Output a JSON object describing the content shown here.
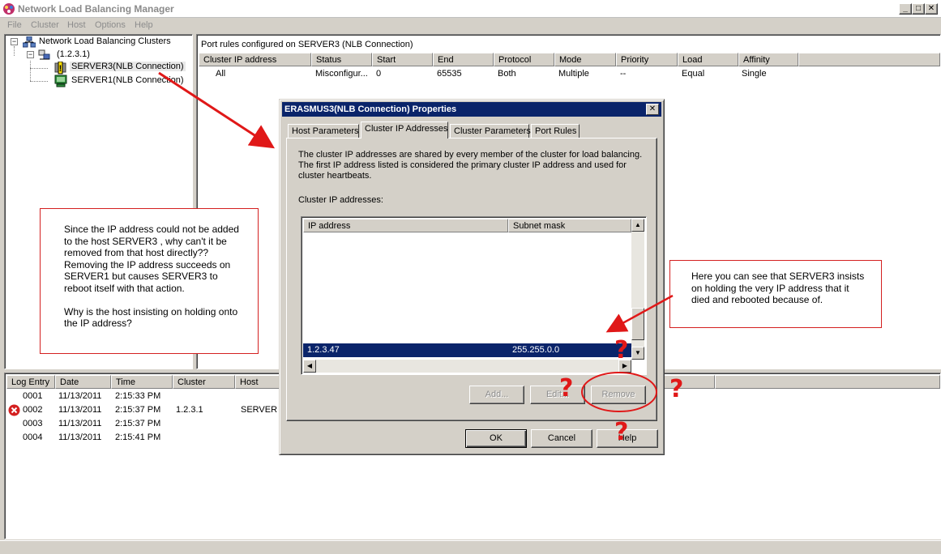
{
  "window": {
    "title": "Network Load Balancing Manager",
    "controls": {
      "minimize": "_",
      "maximize": "□",
      "close": "✕"
    }
  },
  "menu": [
    "File",
    "Cluster",
    "Host",
    "Options",
    "Help"
  ],
  "tree": {
    "root": "Network Load Balancing Clusters",
    "cluster": "(1.2.3.1)",
    "hosts": [
      {
        "label": "SERVER3(NLB Connection)",
        "state": "warning"
      },
      {
        "label": "SERVER1(NLB Connection)",
        "state": "ok"
      }
    ]
  },
  "rules": {
    "title": "Port rules configured on SERVER3 (NLB Connection)",
    "columns": [
      "Cluster IP address",
      "Status",
      "Start",
      "End",
      "Protocol",
      "Mode",
      "Priority",
      "Load",
      "Affinity"
    ],
    "rows": [
      [
        "All",
        "Misconfigur...",
        "0",
        "65535",
        "Both",
        "Multiple",
        "--",
        "Equal",
        "Single"
      ]
    ]
  },
  "log": {
    "columns": [
      "Log Entry",
      "Date",
      "Time",
      "Cluster",
      "Host"
    ],
    "rows": [
      {
        "entry": "0001",
        "date": "11/13/2011",
        "time": "2:15:33 PM",
        "cluster": "",
        "host": "",
        "error": false
      },
      {
        "entry": "0002",
        "date": "11/13/2011",
        "time": "2:15:37 PM",
        "cluster": "1.2.3.1",
        "host": "SERVER",
        "error": true
      },
      {
        "entry": "0003",
        "date": "11/13/2011",
        "time": "2:15:37 PM",
        "cluster": "",
        "host": "",
        "error": false
      },
      {
        "entry": "0004",
        "date": "11/13/2011",
        "time": "2:15:41 PM",
        "cluster": "",
        "host": "",
        "error": false
      }
    ]
  },
  "dialog": {
    "title": "ERASMUS3(NLB Connection) Properties",
    "close": "✕",
    "tabs": [
      "Host Parameters",
      "Cluster IP Addresses",
      "Cluster Parameters",
      "Port Rules"
    ],
    "active_tab": 1,
    "description": "The cluster IP addresses are shared by every member of the cluster for load balancing. The first IP address listed is considered the primary cluster IP address and used for cluster heartbeats.",
    "list_label": "Cluster IP addresses:",
    "list_columns": [
      "IP address",
      "Subnet mask"
    ],
    "list_rows": [
      {
        "ip": "1.2.3.47",
        "mask": "255.255.0.0"
      }
    ],
    "buttons": {
      "add": "Add...",
      "edit": "Edit...",
      "remove": "Remove",
      "ok": "OK",
      "cancel": "Cancel",
      "help": "Help"
    }
  },
  "annotations": {
    "left_note": "Since the IP address could not be added to the host SERVER3 , why can't it be removed from that host directly?? Removing the IP address succeeds on SERVER1 but causes SERVER3 to reboot itself with that action.\n\nWhy is the host insisting on holding onto the IP address?",
    "right_note": "Here you can see that SERVER3 insists on holding the very IP address that it died and rebooted because of.",
    "question_mark": "?",
    "accent_color": "#e01818"
  }
}
